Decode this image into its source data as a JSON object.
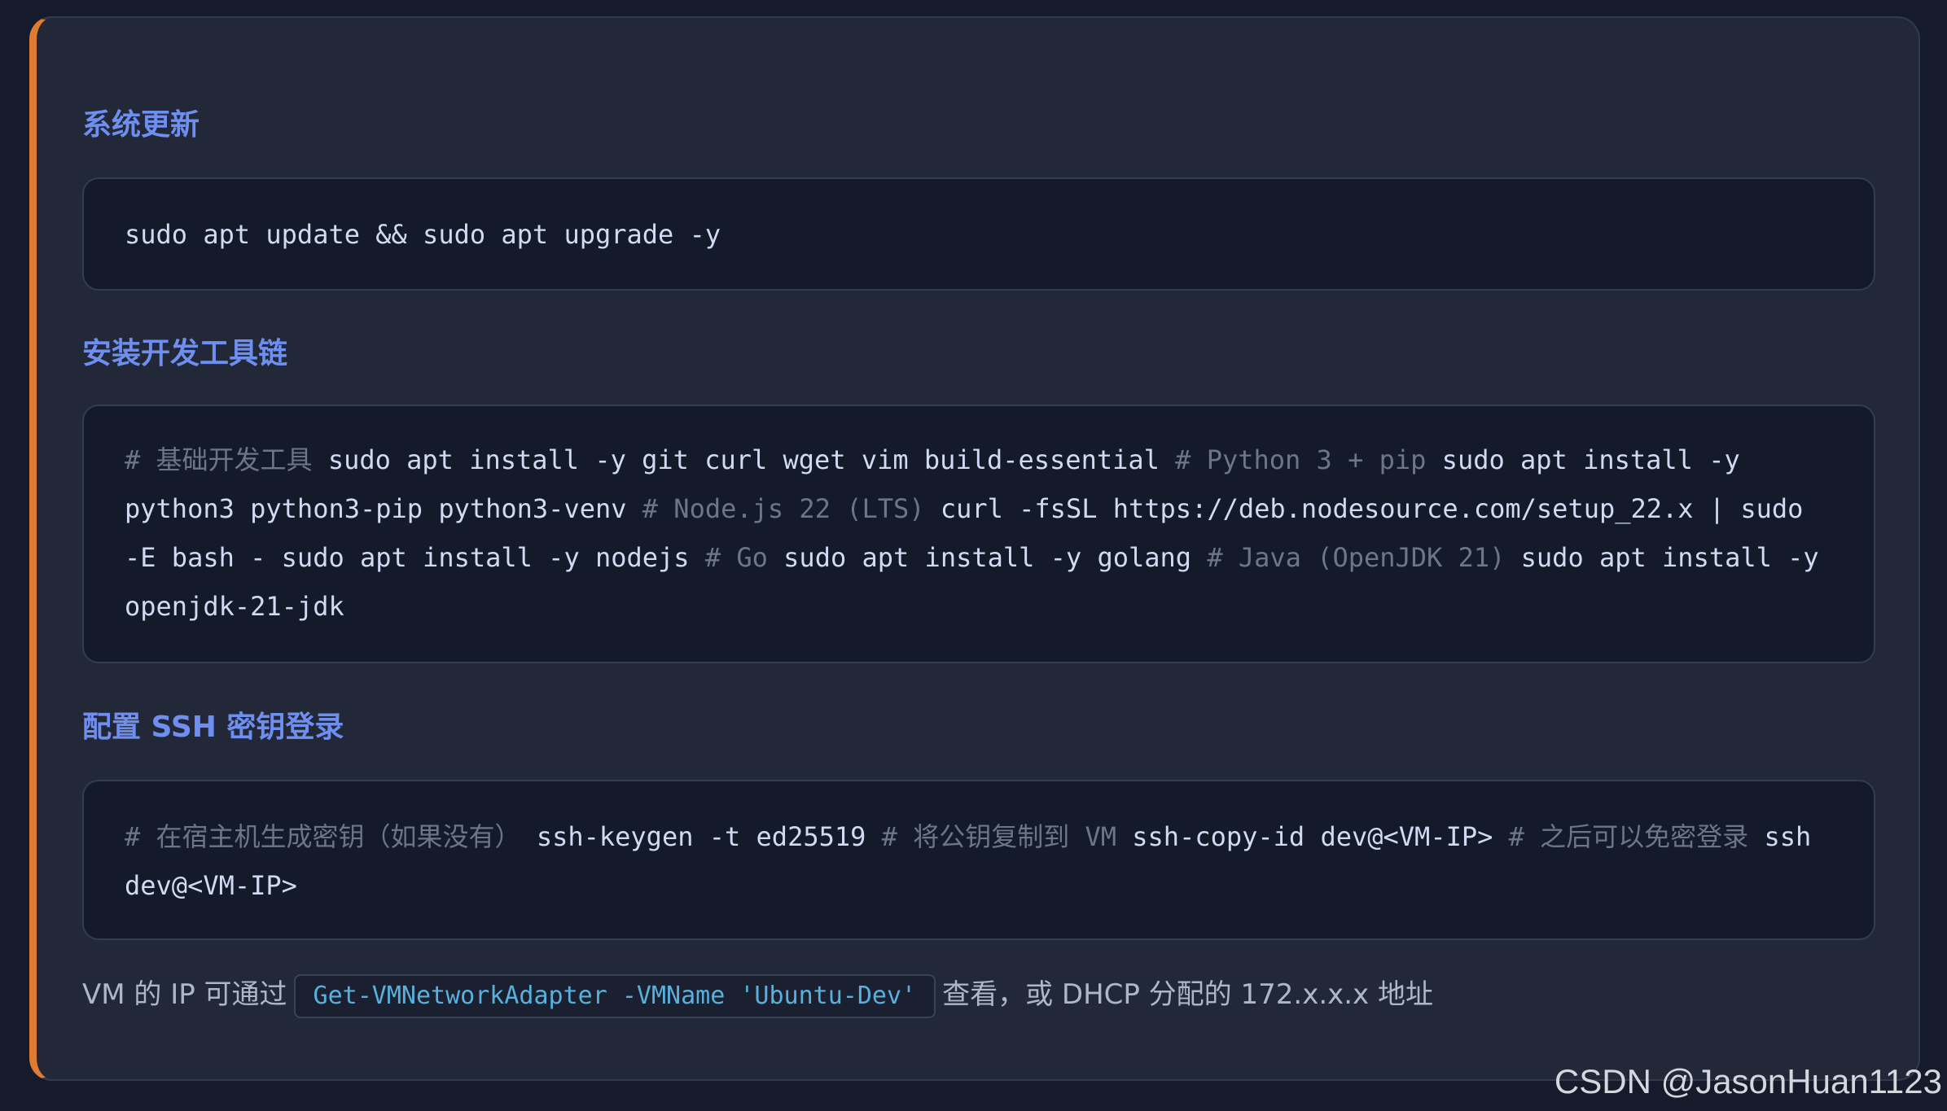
{
  "sections": [
    {
      "title": "系统更新",
      "code": [
        {
          "type": "cmd",
          "text": "sudo apt update && sudo apt upgrade -y"
        }
      ]
    },
    {
      "title": "安装开发工具链",
      "code": [
        {
          "type": "cmt",
          "text": "# 基础开发工具 "
        },
        {
          "type": "cmd",
          "text": "sudo apt install -y git curl wget vim build-essential "
        },
        {
          "type": "cmt",
          "text": "# Python 3 + pip "
        },
        {
          "type": "cmd",
          "text": "sudo apt install -y python3 python3-pip python3-venv "
        },
        {
          "type": "cmt",
          "text": "# Node.js 22 (LTS) "
        },
        {
          "type": "cmd",
          "text": "curl -fsSL https://deb.nodesource.com/setup_22.x | sudo -E bash - sudo apt install -y nodejs "
        },
        {
          "type": "cmt",
          "text": "# Go "
        },
        {
          "type": "cmd",
          "text": "sudo apt install -y golang "
        },
        {
          "type": "cmt",
          "text": "# Java (OpenJDK 21) "
        },
        {
          "type": "cmd",
          "text": "sudo apt install -y openjdk-21-jdk"
        }
      ]
    },
    {
      "title": "配置 SSH 密钥登录",
      "code": [
        {
          "type": "cmt",
          "text": "# 在宿主机生成密钥（如果没有） "
        },
        {
          "type": "cmd",
          "text": "ssh-keygen -t ed25519 "
        },
        {
          "type": "cmt",
          "text": "# 将公钥复制到 VM "
        },
        {
          "type": "cmd",
          "text": "ssh-copy-id dev@<VM-IP> "
        },
        {
          "type": "cmt",
          "text": "# 之后可以免密登录 "
        },
        {
          "type": "cmd",
          "text": "ssh dev@<VM-IP>"
        }
      ]
    }
  ],
  "note": {
    "before": "VM 的 IP 可通过",
    "code": "Get-VMNetworkAdapter -VMName 'Ubuntu-Dev'",
    "after": "查看，或 DHCP 分配的 172.x.x.x 地址"
  },
  "watermark": "CSDN @JasonHuan1123",
  "colors": {
    "accent_border": "#e07b34",
    "heading": "#6f8ff0",
    "comment": "#6e7588",
    "inline_code": "#59b0dc"
  }
}
